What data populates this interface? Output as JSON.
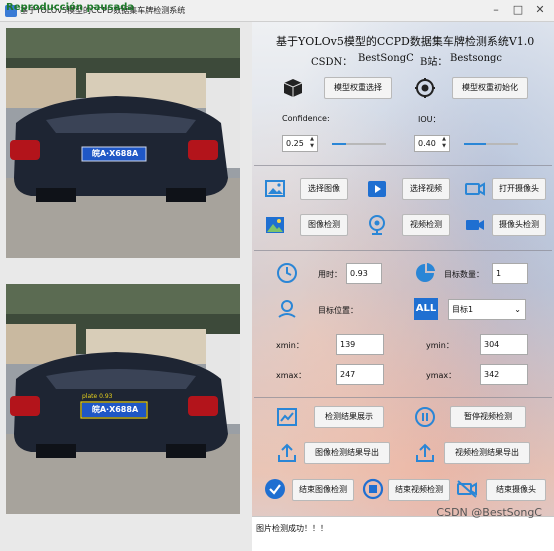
{
  "window": {
    "title": "基于YOLOv5模型的CCPD数据集车牌检测系统",
    "overlay_text": "Reproducción pausada"
  },
  "left_panel": {
    "original_plate": "皖A·X688A",
    "detected_plate": "皖A·X688A",
    "detection_label": "plate 0.93"
  },
  "header": {
    "title": "基于YOLOv5模型的CCPD数据集车牌检测系统V1.0",
    "csdn_label": "CSDN：",
    "csdn_value": "BestSongC",
    "bilibili_label": "B站：",
    "bilibili_value": "Bestsongc"
  },
  "model": {
    "select_weights": "模型权重选择",
    "init_weights": "模型权重初始化",
    "confidence_label": "Confidence:",
    "confidence_value": "0.25",
    "confidence_level": 0.25,
    "iou_label": "IOU：",
    "iou_value": "0.40",
    "iou_level": 0.4
  },
  "inputs": {
    "select_image": "选择图像",
    "select_video": "选择视频",
    "open_camera": "打开摄像头",
    "image_detect": "图像检测",
    "video_detect": "视频检测",
    "camera_detect": "摄像头检测"
  },
  "stats": {
    "time_label": "用时：",
    "time_value": "0.93",
    "count_label": "目标数量：",
    "count_value": "1",
    "position_label": "目标位置：",
    "target_select": "目标1",
    "xmin_label": "xmin：",
    "xmin_value": "139",
    "ymin_label": "ymin：",
    "ymin_value": "304",
    "xmax_label": "xmax：",
    "xmax_value": "247",
    "ymax_label": "ymax：",
    "ymax_value": "342"
  },
  "actions": {
    "show_results": "检测结果展示",
    "pause_video": "暂停视频检测",
    "export_image": "图像检测结果导出",
    "export_video": "视频检测结果导出",
    "end_image": "结束图像检测",
    "end_video": "结束视频检测",
    "end_camera": "结束摄像头"
  },
  "status": {
    "message": "图片检测成功！！！"
  },
  "watermark": "CSDN @BestSongC",
  "colors": {
    "accent": "#2a86d6",
    "plate_blue": "#1f57c6"
  }
}
